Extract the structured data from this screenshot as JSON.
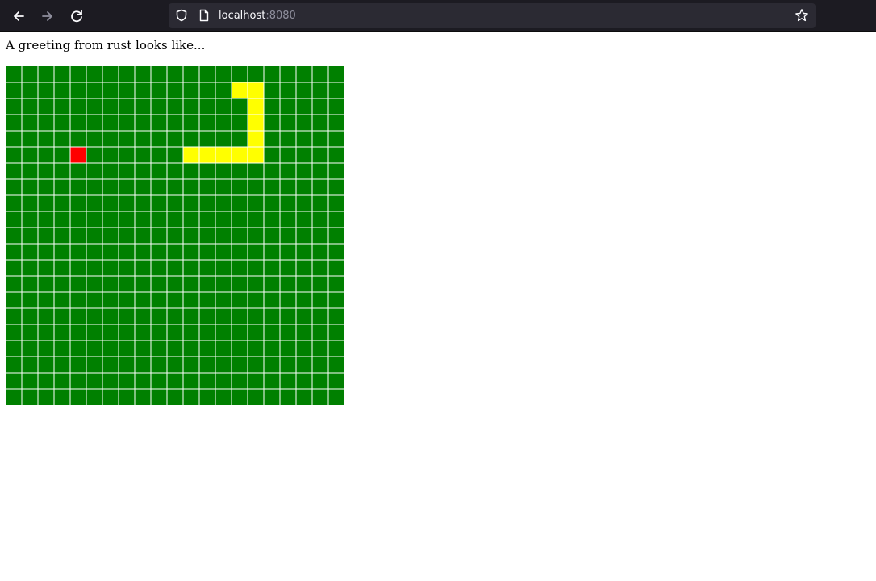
{
  "browser": {
    "url_host": "localhost",
    "url_port": ":8080",
    "icons": {
      "back": "arrow-left-icon",
      "forward": "arrow-right-icon",
      "reload": "reload-icon",
      "tracking_protection": "shield-icon",
      "page_info": "page-icon",
      "bookmark": "star-icon"
    }
  },
  "page": {
    "greeting": "A greeting from rust looks like..."
  },
  "game": {
    "grid_cols": 21,
    "grid_rows": 21,
    "colors": {
      "background": "#008000",
      "grid_line": "#ffffff",
      "snake": "#ffff00",
      "food": "#ff0000"
    },
    "snake_cells": [
      [
        14,
        1
      ],
      [
        15,
        1
      ],
      [
        15,
        2
      ],
      [
        15,
        3
      ],
      [
        15,
        4
      ],
      [
        15,
        5
      ],
      [
        14,
        5
      ],
      [
        13,
        5
      ],
      [
        12,
        5
      ],
      [
        11,
        5
      ]
    ],
    "food_cell": [
      4,
      5
    ]
  }
}
